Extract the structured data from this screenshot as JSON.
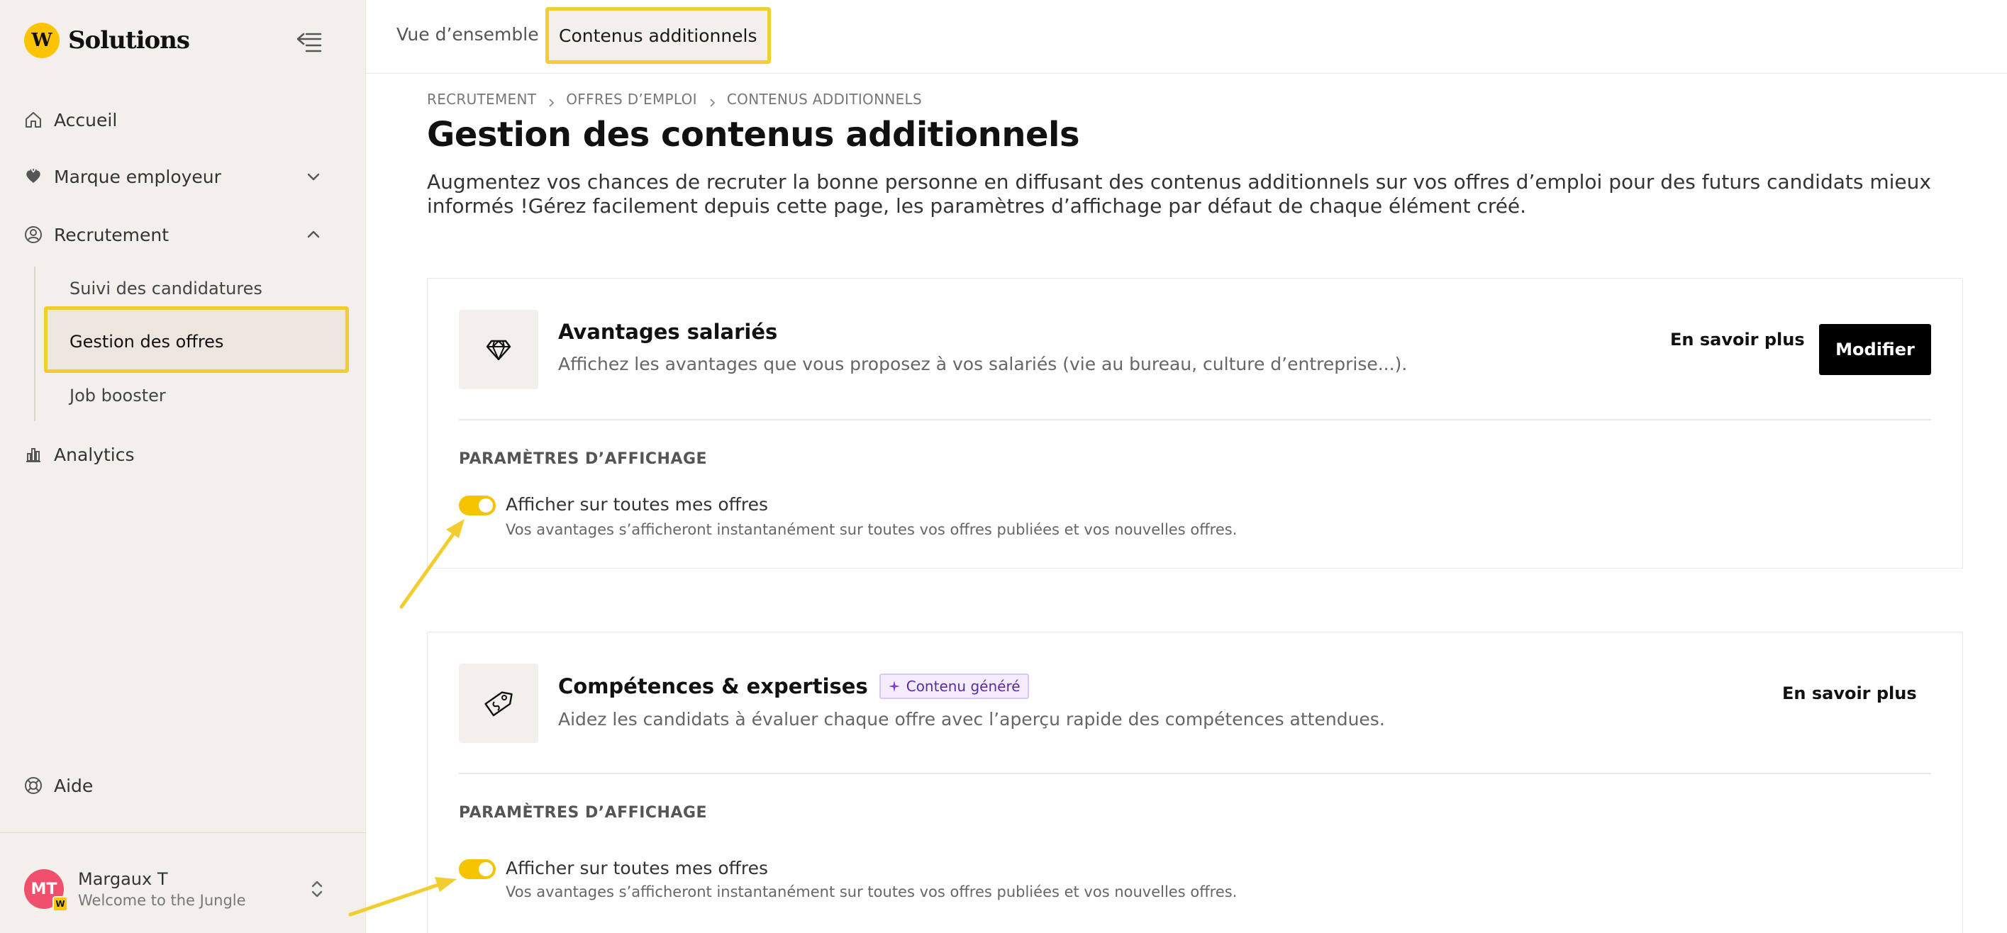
{
  "app": {
    "brand_logo": "W",
    "brand_name": "Solutions"
  },
  "sidebar": {
    "items": [
      {
        "label": "Accueil",
        "icon": "home-icon"
      },
      {
        "label": "Marque employeur",
        "icon": "heart-icon"
      },
      {
        "label": "Recrutement",
        "icon": "user-circle-icon"
      },
      {
        "label": "Analytics",
        "icon": "bar-chart-icon"
      }
    ],
    "recrutement_sub": [
      {
        "label": "Suivi des candidatures"
      },
      {
        "label": "Gestion des offres"
      },
      {
        "label": "Job booster"
      }
    ],
    "help_label": "Aide"
  },
  "user": {
    "initials": "MT",
    "name": "Margaux T",
    "subtitle": "Welcome to the Jungle"
  },
  "tabs": [
    {
      "label": "Vue d’ensemble"
    },
    {
      "label": "Contenus additionnels"
    }
  ],
  "breadcrumb": [
    "RECRUTEMENT",
    "OFFRES D’EMPLOI",
    "CONTENUS ADDITIONNELS"
  ],
  "page": {
    "title": "Gestion des contenus additionnels",
    "description": "Augmentez vos chances de recruter la bonne personne en diffusant des contenus additionnels sur vos offres d’emploi pour des futurs candidats mieux informés !Gérez facilement depuis cette page, les paramètres d’affichage par défaut de chaque élément créé."
  },
  "cards": [
    {
      "icon": "diamond-icon",
      "title": "Avantages salariés",
      "description": "Affichez les avantages que vous proposez à vos salariés (vie au bureau, culture d’entreprise...).",
      "learn_more": "En savoir plus",
      "modify": "Modifier",
      "section_label": "PARAMÈTRES D’AFFICHAGE",
      "toggle_on": true,
      "toggle_label": "Afficher sur toutes mes offres",
      "toggle_help": "Vos avantages s’afficheront instantanément sur toutes vos offres publiées et vos nouvelles offres."
    },
    {
      "icon": "price-tag-icon",
      "title": "Compétences & expertises",
      "badge": "Contenu généré",
      "description": "Aidez les candidats à évaluer chaque offre avec l’aperçu rapide des compétences attendues.",
      "learn_more": "En savoir plus",
      "section_label": "PARAMÈTRES D’AFFICHAGE",
      "toggle_on": true,
      "toggle_label": "Afficher sur toutes mes offres",
      "toggle_help": "Vos avantages s’afficheront instantanément sur toutes vos offres publiées et vos nouvelles offres."
    }
  ],
  "colors": {
    "accent": "#fcc400",
    "highlight": "#f2cd2f",
    "sidebar_bg": "#f3f0ec",
    "primary_button": "#000000",
    "avatar": "#f0506e",
    "badge_text": "#5a2ca0"
  }
}
